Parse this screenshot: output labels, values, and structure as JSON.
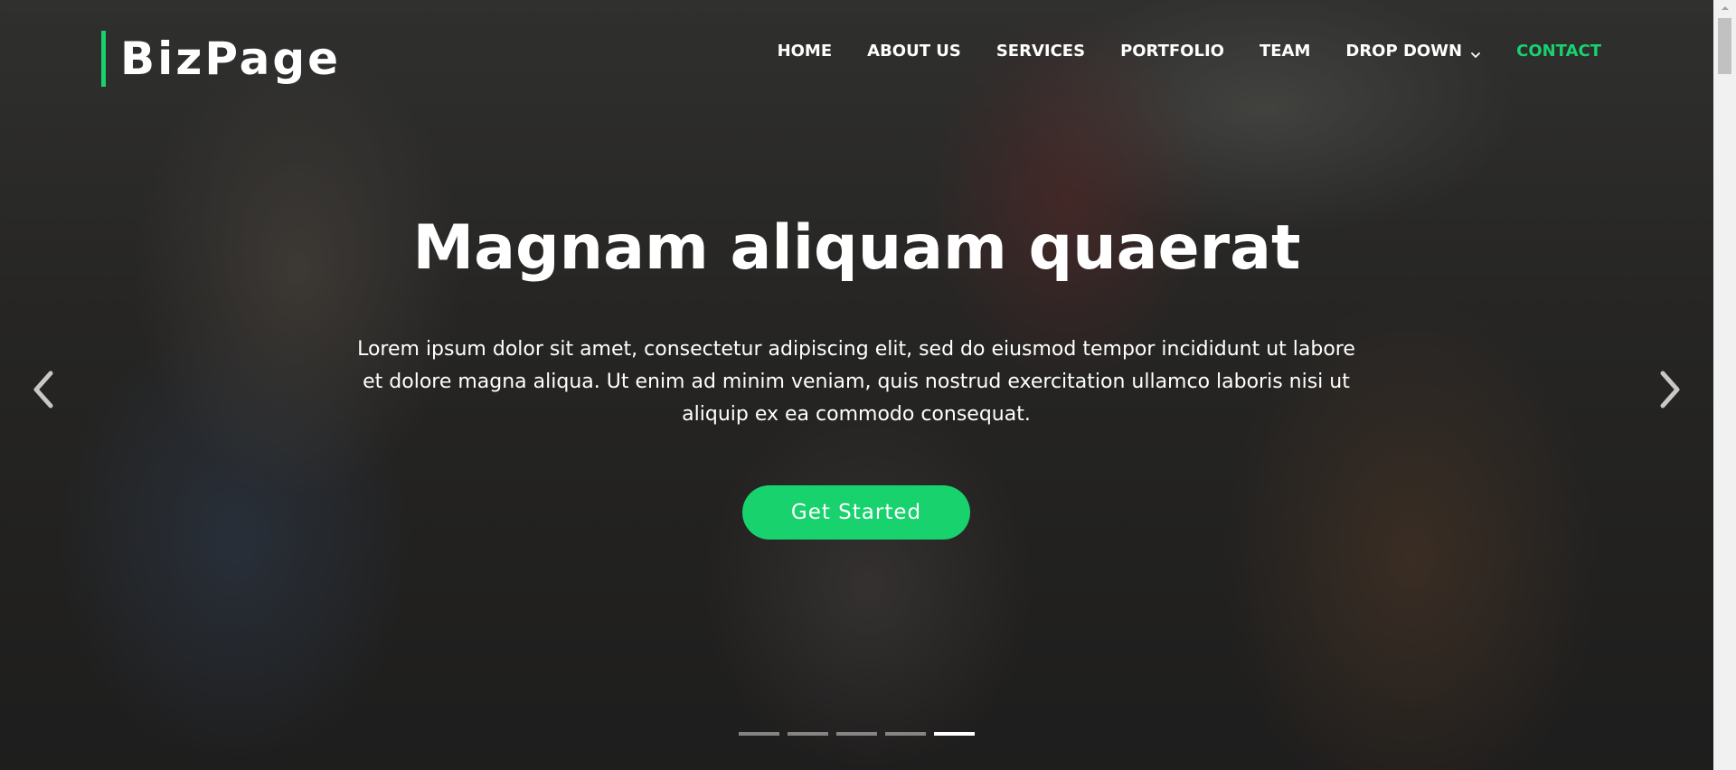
{
  "brand": {
    "name": "BizPage",
    "accent_color": "#18d26e"
  },
  "nav": {
    "items": [
      {
        "label": "HOME"
      },
      {
        "label": "ABOUT US"
      },
      {
        "label": "SERVICES"
      },
      {
        "label": "PORTFOLIO"
      },
      {
        "label": "TEAM"
      },
      {
        "label": "DROP DOWN",
        "icon": "chevron-down-icon"
      },
      {
        "label": "CONTACT",
        "active": true
      }
    ]
  },
  "hero": {
    "title": "Magnam aliquam quaerat",
    "text": "Lorem ipsum dolor sit amet, consectetur adipiscing elit, sed do eiusmod tempor incididunt ut labore et dolore magna aliqua. Ut enim ad minim veniam, quis nostrud exercitation ullamco laboris nisi ut aliquip ex ea commodo consequat.",
    "cta_label": "Get Started",
    "prev_icon": "chevron-left-icon",
    "next_icon": "chevron-right-icon"
  },
  "carousel": {
    "slide_count": 5,
    "active_index": 4
  }
}
